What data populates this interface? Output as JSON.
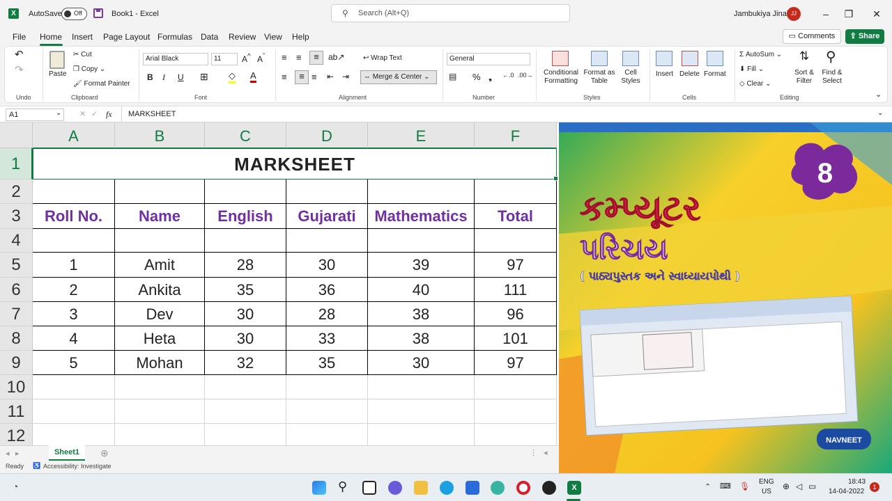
{
  "titlebar": {
    "autosave_label": "AutoSave",
    "autosave_state": "Off",
    "book_title": "Book1  -  Excel",
    "search_placeholder": "Search (Alt+Q)",
    "user_name": "Jambukiya Jinal",
    "user_initials": "JJ"
  },
  "menu": {
    "items": [
      "File",
      "Home",
      "Insert",
      "Page Layout",
      "Formulas",
      "Data",
      "Review",
      "View",
      "Help"
    ],
    "comments_label": "Comments",
    "share_label": "Share"
  },
  "ribbon": {
    "undo_group": "Undo",
    "paste_label": "Paste",
    "cut_label": "Cut",
    "copy_label": "Copy",
    "format_painter_label": "Format Painter",
    "clipboard_group": "Clipboard",
    "font_name": "Arial Black",
    "font_size": "11",
    "font_group": "Font",
    "wrap_text_label": "Wrap Text",
    "merge_center_label": "Merge & Center",
    "alignment_group": "Alignment",
    "number_format": "General",
    "number_group": "Number",
    "conditional_formatting_label": "Conditional Formatting",
    "format_as_table_label": "Format as Table",
    "cell_styles_label": "Cell Styles",
    "styles_group": "Styles",
    "insert_label": "Insert",
    "delete_label": "Delete",
    "format_label": "Format",
    "cells_group": "Cells",
    "autosum_label": "AutoSum",
    "fill_label": "Fill",
    "clear_label": "Clear",
    "sort_filter_label": "Sort & Filter",
    "find_select_label": "Find & Select",
    "editing_group": "Editing"
  },
  "formula_bar": {
    "name_box": "A1",
    "formula": "MARKSHEET"
  },
  "sheet": {
    "columns": [
      "A",
      "B",
      "C",
      "D",
      "E",
      "F"
    ],
    "rows": [
      "1",
      "2",
      "3",
      "4",
      "5",
      "6",
      "7",
      "8",
      "9",
      "10",
      "11",
      "12"
    ],
    "title": "MARKSHEET",
    "headers": [
      "Roll No.",
      "Name",
      "English",
      "Gujarati",
      "Mathematics",
      "Total"
    ],
    "data": [
      [
        "1",
        "Amit",
        "28",
        "30",
        "39",
        "97"
      ],
      [
        "2",
        "Ankita",
        "35",
        "36",
        "40",
        "111"
      ],
      [
        "3",
        "Dev",
        "30",
        "28",
        "38",
        "96"
      ],
      [
        "4",
        "Heta",
        "30",
        "33",
        "38",
        "101"
      ],
      [
        "5",
        "Mohan",
        "32",
        "35",
        "30",
        "97"
      ]
    ],
    "tab_name": "Sheet1"
  },
  "status": {
    "ready": "Ready",
    "accessibility": "Accessibility: Investigate"
  },
  "cover": {
    "grade": "8",
    "title_line1": "કમ્પ્યૂટર",
    "title_line2": "પરિચય",
    "subtitle": "( પાઠ્યપુસ્તક અને સ્વાધ્યાયપોથી )",
    "publisher": "NAVNEET"
  },
  "taskbar": {
    "lang_line1": "ENG",
    "lang_line2": "US",
    "time": "18:43",
    "date": "14-04-2022",
    "notification_count": "1"
  },
  "colors": {
    "excel_green": "#107c41",
    "header_purple": "#7030a0"
  }
}
